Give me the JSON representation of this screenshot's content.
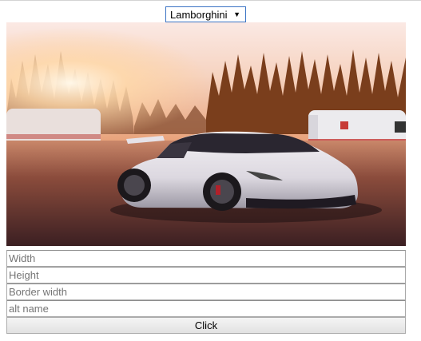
{
  "car_select": {
    "selected": "Lamborghini",
    "caret_icon": "triangle-down-icon"
  },
  "photo": {
    "subject": "white sports car"
  },
  "form": {
    "width_placeholder": "Width",
    "height_placeholder": "Height",
    "border_placeholder": "Border width",
    "alt_placeholder": "alt name",
    "submit_label": "Click"
  }
}
